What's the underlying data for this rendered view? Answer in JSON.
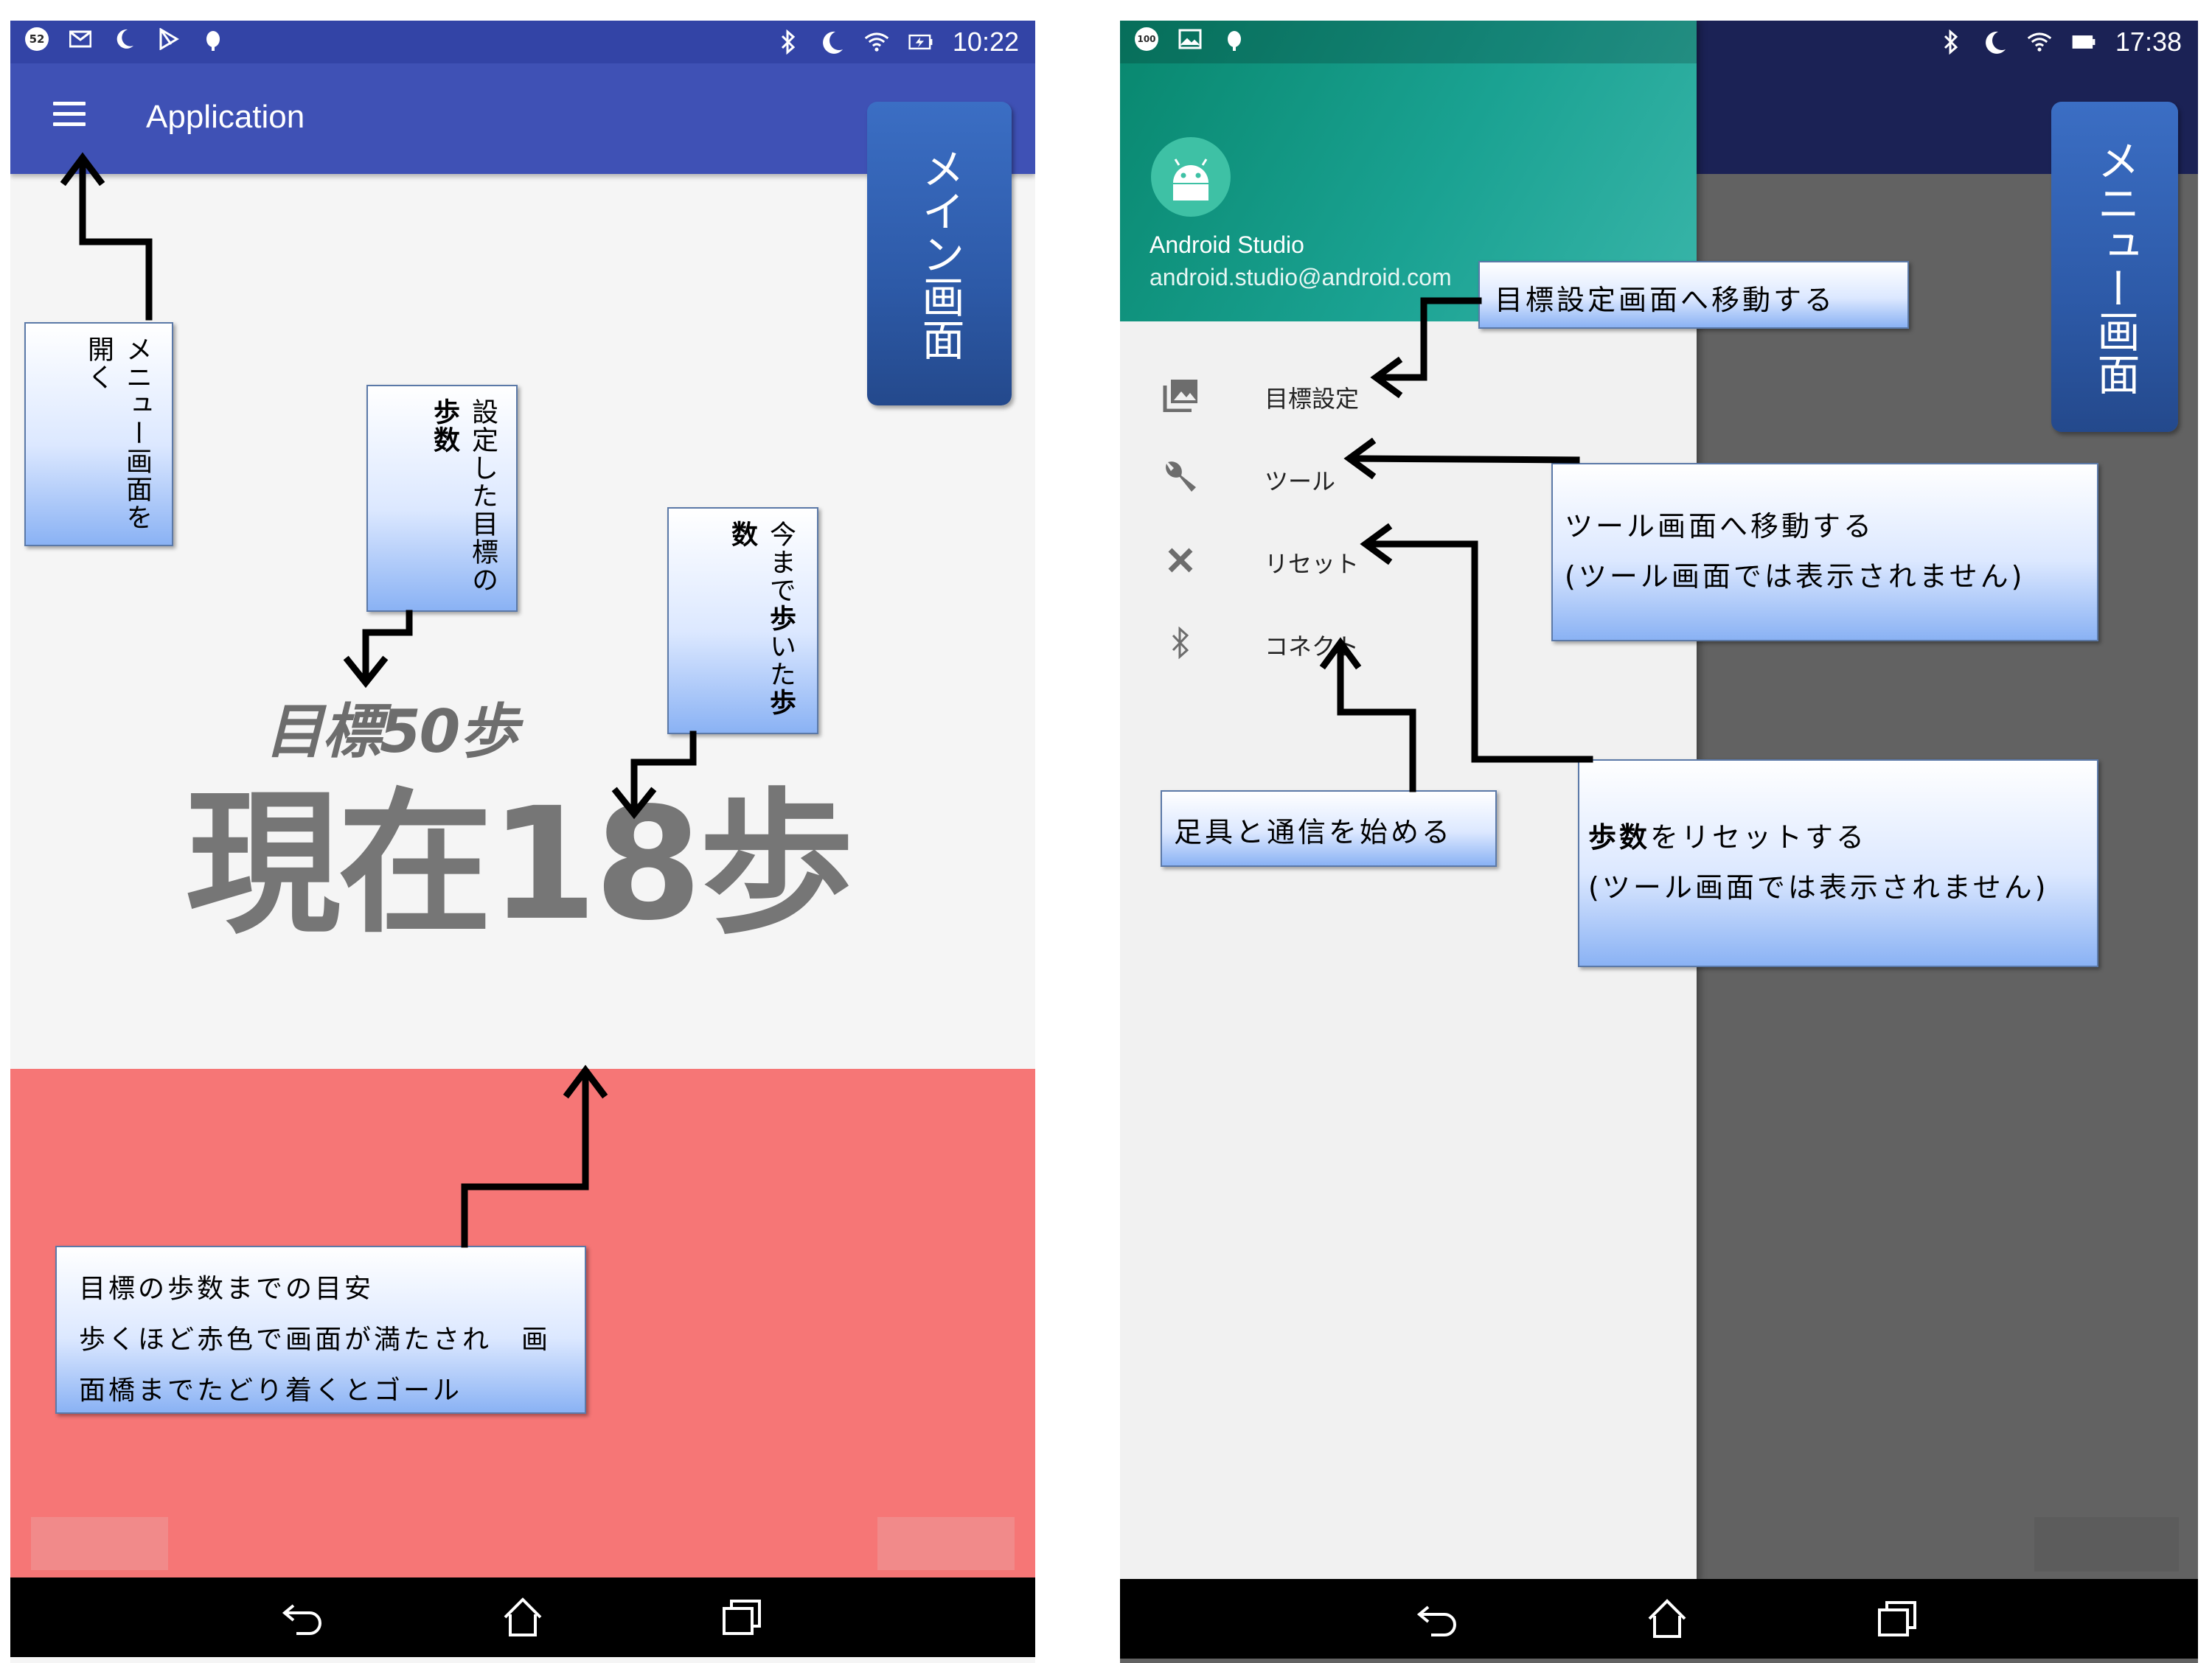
{
  "main_screen": {
    "status_bar": {
      "notification_count": "52",
      "time": "10:22",
      "left_icons": [
        "notification-count-badge",
        "mail-icon",
        "do-not-disturb-moon-icon",
        "play-store-icon",
        "android-debug-icon"
      ],
      "right_icons": [
        "bluetooth-icon",
        "moon-icon",
        "wifi-icon",
        "battery-charging-icon"
      ]
    },
    "app_bar": {
      "title": "Application",
      "menu_icon": "hamburger-menu-icon"
    },
    "goal_text": "目標50歩",
    "current_text": "現在18歩",
    "colors": {
      "app_bar": "#3f51b5",
      "background": "#f5f5f5",
      "progress_fill": "#f67676"
    }
  },
  "menu_screen": {
    "status_bar": {
      "notification_count": "100",
      "time": "17:38",
      "left_icons": [
        "notification-count-badge",
        "image-icon",
        "android-debug-icon"
      ],
      "right_icons": [
        "bluetooth-icon",
        "moon-icon",
        "wifi-icon",
        "battery-icon"
      ]
    },
    "drawer_header": {
      "name": "Android Studio",
      "email": "android.studio@android.com",
      "avatar_icon": "android-robot-icon"
    },
    "menu_items": [
      {
        "label": "目標設定",
        "icon": "photo-icon"
      },
      {
        "label": "ツール",
        "icon": "wrench-icon"
      },
      {
        "label": "リセット",
        "icon": "close-icon"
      },
      {
        "label": "コネクト",
        "icon": "bluetooth-icon"
      }
    ],
    "colors": {
      "drawer_header": "#0f9a82",
      "scrim": "#626262"
    }
  },
  "labels": {
    "main_screen_title": "メイン画面",
    "menu_screen_title": "メニュー画面"
  },
  "annotations": {
    "open_menu": "メニュー画面を開く",
    "goal_steps": {
      "part1": "設定した目標の",
      "bold": "歩数"
    },
    "walked_steps": {
      "part1": "今まで",
      "bold1": "歩",
      "part2": "いた",
      "bold2": "歩数"
    },
    "progress_desc": {
      "line1": "目標の歩数までの目安",
      "line2": "歩くほど赤色で画面が満たされ　画",
      "line3": "面橋までたどり着くとゴール"
    },
    "goal_setting": "目標設定画面へ移動する",
    "tool": {
      "line1": "ツール画面へ移動する",
      "line2": "(ツール画面では表示されません)"
    },
    "reset": {
      "bold": "歩数",
      "line1": "をリセットする",
      "line2": "(ツール画面では表示されません)"
    },
    "connect": "足具と通信を始める"
  }
}
